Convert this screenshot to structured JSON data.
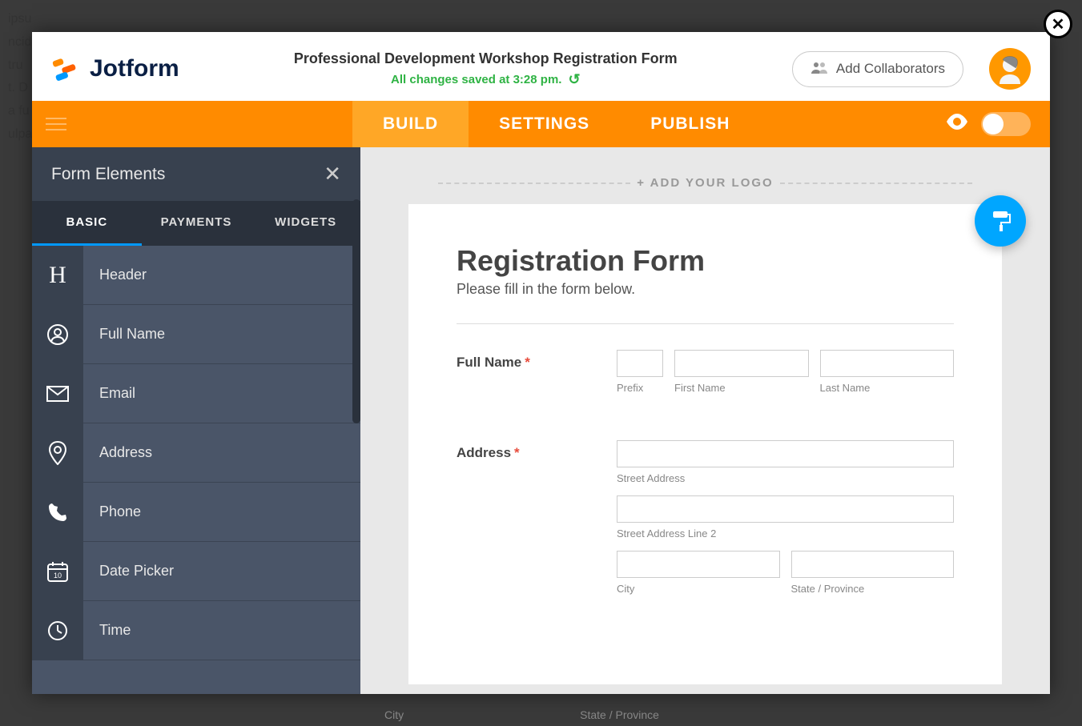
{
  "brand": "Jotform",
  "header": {
    "form_title": "Professional Development Workshop Registration Form",
    "save_status": "All changes saved at 3:28 pm.",
    "collab_label": "Add Collaborators"
  },
  "nav": {
    "tabs": [
      "BUILD",
      "SETTINGS",
      "PUBLISH"
    ],
    "active": 0
  },
  "sidebar": {
    "title": "Form Elements",
    "tabs": [
      "BASIC",
      "PAYMENTS",
      "WIDGETS"
    ],
    "active": 0,
    "elements": [
      {
        "label": "Header",
        "icon": "H"
      },
      {
        "label": "Full Name",
        "icon": "user"
      },
      {
        "label": "Email",
        "icon": "mail"
      },
      {
        "label": "Address",
        "icon": "pin"
      },
      {
        "label": "Phone",
        "icon": "phone"
      },
      {
        "label": "Date Picker",
        "icon": "calendar"
      },
      {
        "label": "Time",
        "icon": "clock"
      }
    ]
  },
  "canvas": {
    "logo_drop": "+ ADD YOUR LOGO",
    "heading": "Registration Form",
    "subheading": "Please fill in the form below.",
    "fields": {
      "fullname": {
        "label": "Full Name",
        "sub_prefix": "Prefix",
        "sub_first": "First Name",
        "sub_last": "Last Name"
      },
      "address": {
        "label": "Address",
        "sub_street": "Street Address",
        "sub_street2": "Street Address Line 2",
        "sub_city": "City",
        "sub_state": "State / Province"
      }
    }
  },
  "footer": {
    "city": "City",
    "state": "State / Province"
  }
}
